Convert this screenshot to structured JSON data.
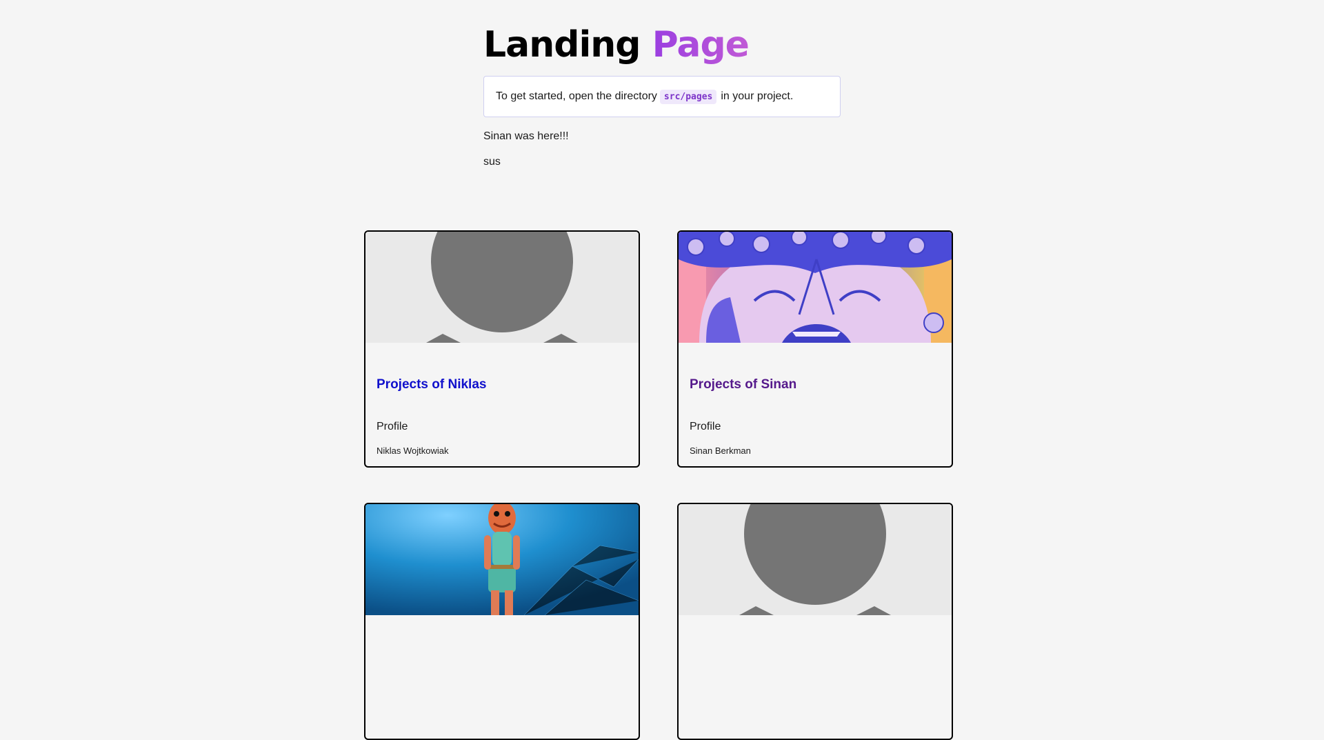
{
  "header": {
    "title_main": "Landing",
    "title_accent": "Page"
  },
  "instructions": {
    "before": "To get started, open the directory",
    "code": "src/pages",
    "after": "in your project."
  },
  "paragraphs": [
    "Sinan was here!!!",
    "sus"
  ],
  "cards": [
    {
      "title": "Projects of Niklas",
      "subtitle": "Profile",
      "name": "Niklas Wojtkowiak",
      "image": "placeholder-avatar",
      "link_color": "#1010cc"
    },
    {
      "title": "Projects of Sinan",
      "subtitle": "Profile",
      "name": "Sinan Berkman",
      "image": "anime-avatar",
      "link_color": "#55198b"
    },
    {
      "image": "fishstick-avatar"
    },
    {
      "image": "placeholder-avatar"
    }
  ],
  "colors": {
    "background": "#f5f5f5",
    "accent": "#9b3fe0",
    "code_text": "#7d34c9"
  }
}
